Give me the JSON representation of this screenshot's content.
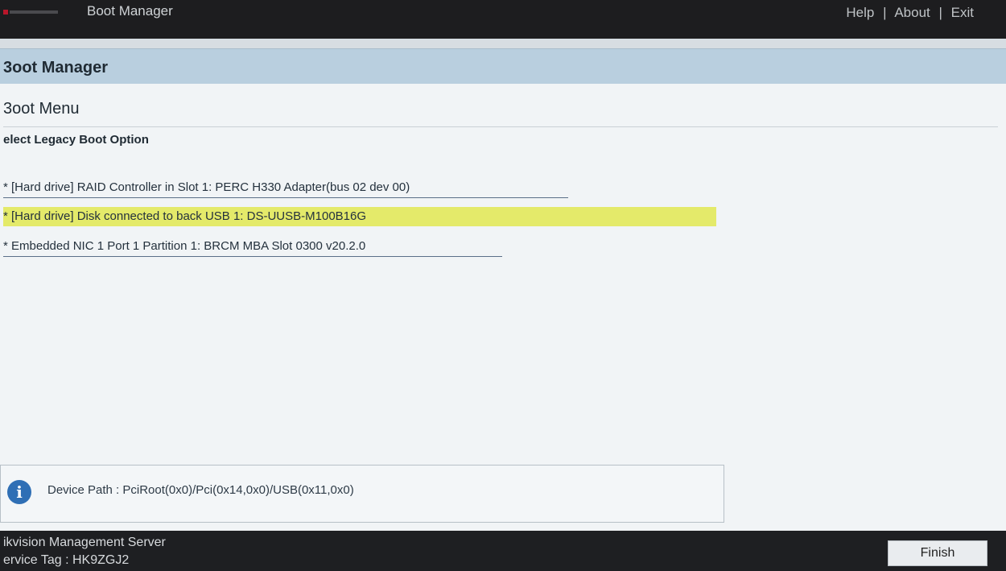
{
  "topbar": {
    "title": "Boot Manager",
    "links": [
      "Help",
      "About",
      "Exit"
    ],
    "separator": "|"
  },
  "page": {
    "title": "3oot Manager"
  },
  "menu": {
    "title": "3oot Menu",
    "section_label": "elect Legacy Boot Option",
    "options": [
      "* [Hard drive] RAID Controller in Slot 1: PERC H330 Adapter(bus 02 dev 00)",
      "* [Hard drive] Disk connected to back USB 1: DS-UUSB-M100B16G",
      "* Embedded NIC 1 Port 1 Partition 1: BRCM MBA Slot 0300 v20.2.0"
    ],
    "selected_index": 1
  },
  "info": {
    "icon": "info-icon",
    "icon_glyph": "i",
    "text": "Device Path : PciRoot(0x0)/Pci(0x14,0x0)/USB(0x11,0x0)"
  },
  "footer": {
    "server_name": "ikvision Management Server",
    "service_tag": "ervice Tag : HK9ZGJ2",
    "finish_label": "Finish"
  },
  "colors": {
    "selected_highlight": "#e4ea6a",
    "title_band": "#b9cfdf",
    "info_icon": "#2f6fb5"
  }
}
